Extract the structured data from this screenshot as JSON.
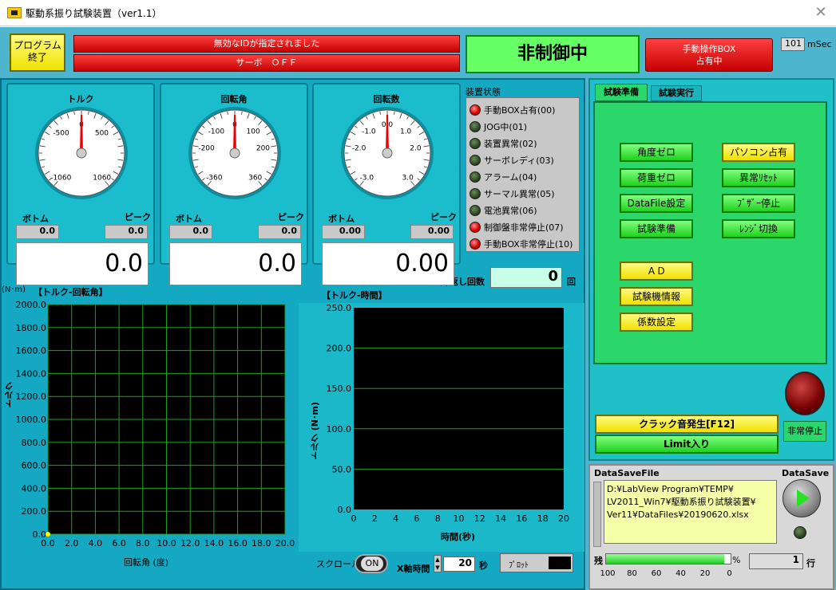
{
  "window": {
    "title": "駆動系振り試験装置（ver1.1）"
  },
  "top": {
    "program_end": "プログラム\n終了",
    "error_msg": "無効なIDが指定されました",
    "servo_msg": "サーボ　ＯＦＦ",
    "control_status": "非制御中",
    "manual_box": "手動操作BOX\n占有中",
    "interval_value": "101",
    "interval_unit": "mSec"
  },
  "gauges": [
    {
      "title": "トルク",
      "bottom_label": "ボトム",
      "peak_label": "ピーク",
      "bottom": "0.0",
      "peak": "0.0",
      "value": "0.0",
      "ticks": [
        "-500",
        "0",
        "500",
        "-1060",
        "1060"
      ]
    },
    {
      "title": "回転角",
      "bottom_label": "ボトム",
      "peak_label": "ピーク",
      "bottom": "0.0",
      "peak": "0.0",
      "value": "0.0",
      "ticks": [
        "-100",
        "0",
        "100",
        "-200",
        "200",
        "-360",
        "360"
      ]
    },
    {
      "title": "回転数",
      "bottom_label": "ボトム",
      "peak_label": "ピーク",
      "bottom": "0.00",
      "peak": "0.00",
      "value": "0.00",
      "ticks": [
        "-1.0",
        "0.0",
        "1.0",
        "-2.0",
        "2.0",
        "-3.0",
        "3.0"
      ]
    }
  ],
  "device_status": {
    "title": "装置状態",
    "items": [
      {
        "label": "手動BOX占有(00)",
        "on": true
      },
      {
        "label": "JOG中(01)",
        "on": false
      },
      {
        "label": "装置異常(02)",
        "on": false
      },
      {
        "label": "サーボレディ(03)",
        "on": false
      },
      {
        "label": "アラーム(04)",
        "on": false
      },
      {
        "label": "サーマル異常(05)",
        "on": false
      },
      {
        "label": "電池異常(06)",
        "on": false
      },
      {
        "label": "制御盤非常停止(07)",
        "on": true
      },
      {
        "label": "手動BOX非常停止(10)",
        "on": true
      }
    ]
  },
  "repeat": {
    "label": "繰返し回数",
    "value": "0",
    "unit": "回"
  },
  "chart1": {
    "title": "【トルク-回転角】",
    "unit": "(N･m)",
    "ylabel": "トルク",
    "xlabel": "回転角 (度)",
    "yticks": [
      "2000.0",
      "1800.0",
      "1600.0",
      "1400.0",
      "1200.0",
      "1000.0",
      "800.0",
      "600.0",
      "400.0",
      "200.0",
      "0.0"
    ],
    "xticks": [
      "0.0",
      "2.0",
      "4.0",
      "6.0",
      "8.0",
      "10.0",
      "12.0",
      "14.0",
      "16.0",
      "18.0",
      "20.0"
    ]
  },
  "chart2": {
    "title": "【トルク-時間】",
    "ylabel": "トルク (N･m)",
    "xlabel": "時間(秒)",
    "yticks": [
      "250.0",
      "200.0",
      "150.0",
      "100.0",
      "50.0",
      "0.0"
    ],
    "xticks": [
      "0",
      "2",
      "4",
      "6",
      "8",
      "10",
      "12",
      "14",
      "16",
      "18",
      "20"
    ]
  },
  "chart_data": [
    {
      "type": "scatter",
      "title": "【トルク-回転角】",
      "xlabel": "回転角 (度)",
      "ylabel": "トルク",
      "xlim": [
        0,
        20
      ],
      "ylim": [
        0,
        2000
      ],
      "grid": true,
      "x": [
        0
      ],
      "y": [
        0
      ],
      "color": "#ffff00"
    },
    {
      "type": "line",
      "title": "【トルク-時間】",
      "xlabel": "時間(秒)",
      "ylabel": "トルク (N･m)",
      "xlim": [
        0,
        20
      ],
      "ylim": [
        0,
        250
      ],
      "grid": true,
      "x": [],
      "y": []
    }
  ],
  "bottom_controls": {
    "scroll_label": "スクロール",
    "scroll_toggle": "ON",
    "xaxis_label": "X軸時間",
    "xaxis_value": "20",
    "xaxis_unit": "秒",
    "plot_label": "ﾌﾟﾛｯﾄ"
  },
  "tabs": [
    {
      "label": "試験準備",
      "active": true
    },
    {
      "label": "試験実行",
      "active": false
    }
  ],
  "buttons_left": [
    "角度ゼロ",
    "荷重ゼロ",
    "DataFile設定",
    "試験準備"
  ],
  "buttons_right": [
    "パソコン占有",
    "異常ﾘｾｯﾄ",
    "ﾌﾞｻﾞｰ停止",
    "ﾚﾝｼﾞ切換"
  ],
  "buttons_yellow": [
    "ＡＤ",
    "試験機情報",
    "係数設定"
  ],
  "click": "クラック音発生[F12]",
  "limit": "Limit入り",
  "estop": "非常停止",
  "datasave": {
    "file_label": "DataSaveFile",
    "path": "D:¥LabView Program¥TEMP¥\nLV2011_Win7¥駆動系振り試験装置¥\nVer11¥DataFiles¥20190620.xlsx",
    "save_label": "DataSave"
  },
  "remaining": {
    "label": "残",
    "unit": "%",
    "percent": 95,
    "ticks": [
      "100",
      "80",
      "60",
      "40",
      "20",
      "0"
    ],
    "rows_value": "1",
    "rows_unit": "行"
  }
}
